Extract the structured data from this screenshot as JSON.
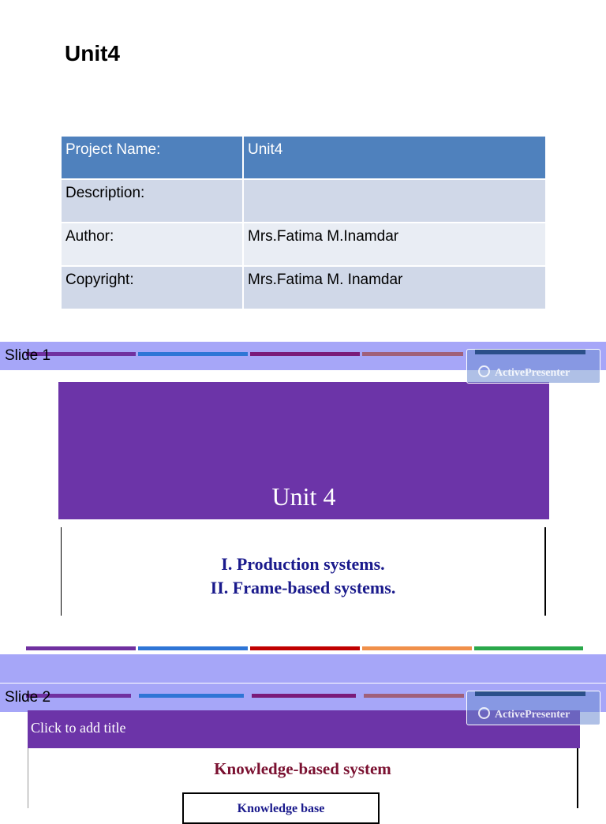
{
  "page": {
    "title": "Unit4"
  },
  "info_table": {
    "rows": [
      {
        "label": "Project Name:",
        "value": "Unit4"
      },
      {
        "label": "Description:",
        "value": ""
      },
      {
        "label": "Author:",
        "value": "Mrs.Fatima M.Inamdar"
      },
      {
        "label": "Copyright:",
        "value": "Mrs.Fatima M. Inamdar"
      }
    ]
  },
  "watermark_text": "ActivePresenter",
  "slides": [
    {
      "label": "Slide 1",
      "title": "Unit 4",
      "items": [
        "I. Production systems.",
        "II. Frame-based systems."
      ]
    },
    {
      "label": "Slide 2",
      "title": "Click to add title",
      "heading": "Knowledge-based system",
      "box": "Knowledge base"
    }
  ],
  "colors": {
    "header_blue": "#4f81bd",
    "slide_purple": "#6c34a8",
    "band_lavender": "#a6a6f8",
    "stripe_purple": "#7030a0",
    "stripe_blue": "#2e75d6",
    "stripe_red": "#c00000",
    "stripe_orange": "#f0904a",
    "stripe_green": "#2aa84a"
  }
}
